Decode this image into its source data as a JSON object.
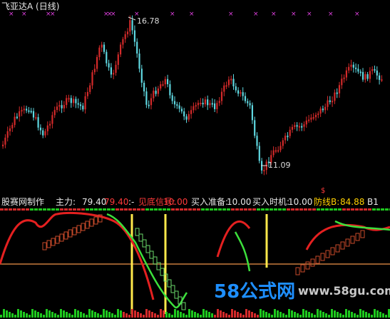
{
  "chart": {
    "title": "飞亚达A (日线)",
    "high_label": "16.78",
    "low_label": "11.09",
    "dollar_marker": "$",
    "colors": {
      "up": "#d42a2a",
      "down": "#5fd7e0",
      "markers": "#e040e0"
    }
  },
  "indicator": {
    "name": "股赛网制作",
    "main_label": "主力:",
    "main_value": "79.40",
    "main_value2": "79.40",
    "items": [
      {
        "label": "见底信号:",
        "value": "10.00",
        "color": "#ff3a3a"
      },
      {
        "label": "买入准备:",
        "value": "10.00",
        "color": "#e8e8e8"
      },
      {
        "label": "买入时机:",
        "value": "10.00",
        "color": "#e8e8e8"
      },
      {
        "label": "防线B:",
        "value": "84.88",
        "color": "#ffd000"
      }
    ],
    "tail_label": "B1"
  },
  "watermark": {
    "big": "58公式网",
    "url": "www.58gu.com"
  }
}
